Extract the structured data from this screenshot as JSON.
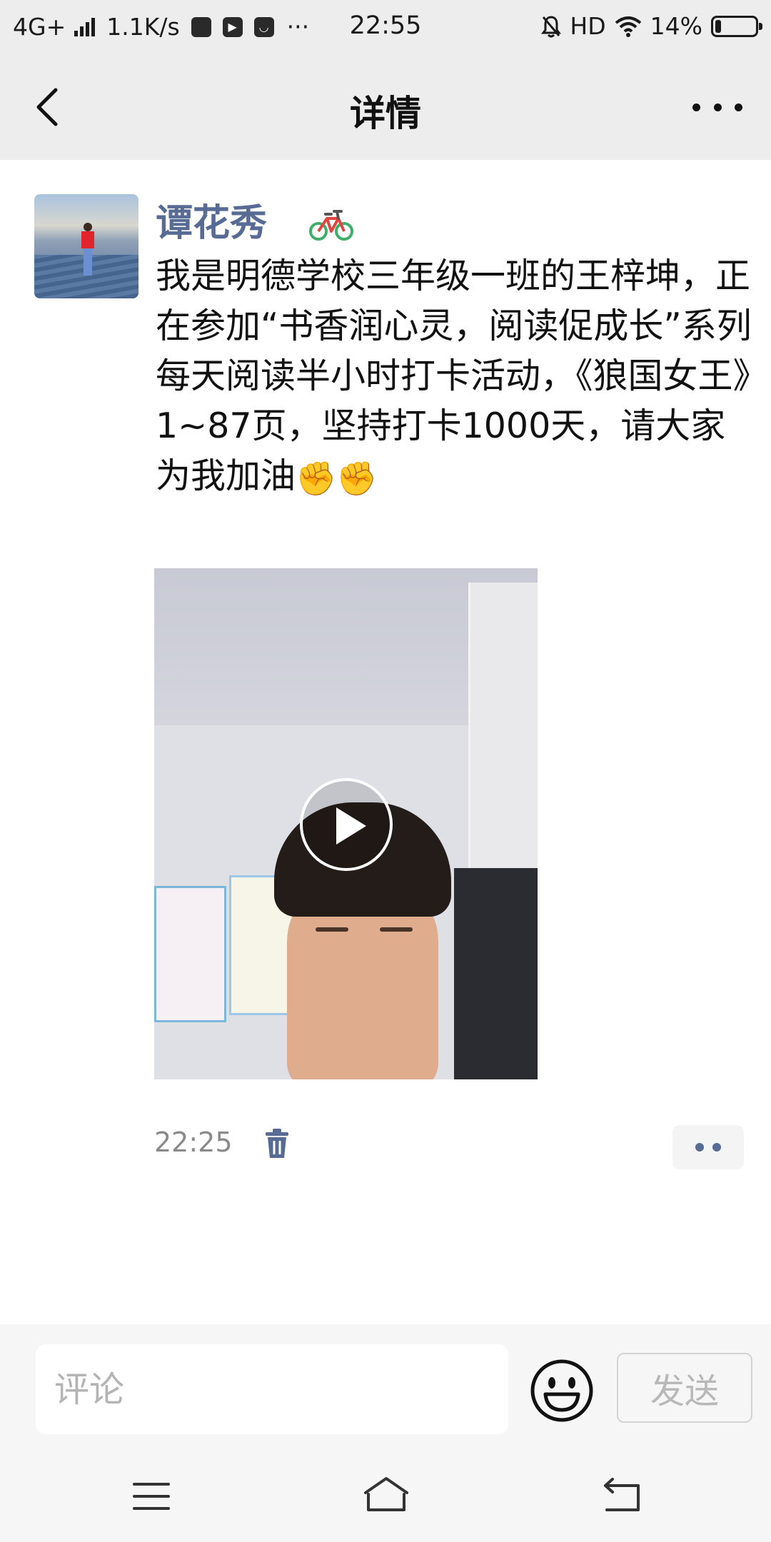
{
  "status_bar": {
    "network": "4G+",
    "speed": "1.1K/s",
    "more": "···",
    "time": "22:55",
    "hd": "HD",
    "battery": "14%",
    "battery_level": 0.14
  },
  "header": {
    "title": "详情"
  },
  "post": {
    "author": "谭花秀",
    "text": "我是明德学校三年级一班的王梓坤，正在参加“书香润心灵，阅读促成长”系列每天阅读半小时打卡活动，《狼国女王》1~87页，坚持打卡1000天，请大家为我加油",
    "emoji": "✊✊",
    "time": "22:25"
  },
  "comment_bar": {
    "placeholder": "评论",
    "send_label": "发送"
  },
  "icons": {
    "back": "chevron-left-icon",
    "more": "more-horizontal-icon",
    "bike": "bicycle-icon",
    "play": "play-icon",
    "delete": "trash-icon",
    "emoji": "smiley-icon",
    "menu": "menu-icon",
    "home": "home-icon",
    "nav_back": "back-icon"
  },
  "colors": {
    "name_link": "#576b95",
    "bar_background": "#ededed"
  }
}
